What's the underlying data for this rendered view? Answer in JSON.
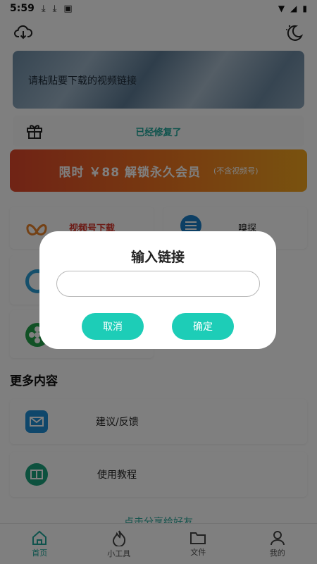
{
  "status_bar": {
    "time": "5:59"
  },
  "banner": {
    "hint": "请粘贴要下载的视频链接"
  },
  "notice": {
    "text": "已经修复了"
  },
  "vip": {
    "main": "限时 ￥88 解锁永久会员",
    "sub": "(不含视频号)"
  },
  "tools": [
    {
      "label": "视频号下载"
    },
    {
      "label": "嗅探"
    }
  ],
  "more": {
    "title": "更多内容",
    "items": [
      {
        "label": "建议/反馈"
      },
      {
        "label": "使用教程"
      }
    ],
    "share": "点击分享给好友"
  },
  "nav": [
    {
      "label": "首页"
    },
    {
      "label": "小工具"
    },
    {
      "label": "文件"
    },
    {
      "label": "我的"
    }
  ],
  "dialog": {
    "title": "输入链接",
    "input_value": "",
    "cancel": "取消",
    "confirm": "确定"
  },
  "colors": {
    "accent": "#1dcdb7",
    "nav_active": "#1ea79a",
    "vip_start": "#e0472b",
    "vip_end": "#f2a51f",
    "tool_label_red": "#d9352b"
  }
}
